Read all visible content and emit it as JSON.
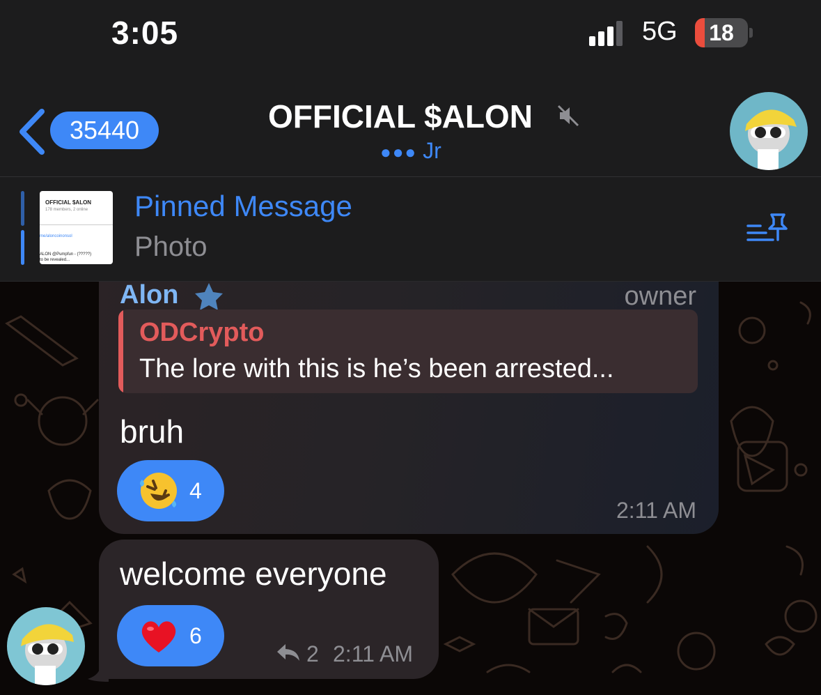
{
  "status_bar": {
    "time": "3:05",
    "network": "5G",
    "battery": "18",
    "battery_level_pct": 18,
    "signal_bars": 3
  },
  "header": {
    "unread_count": "35440",
    "title": "OFFICIAL $ALON",
    "typing_user": "Jr"
  },
  "pinned": {
    "label": "Pinned Message",
    "preview": "Photo",
    "thumb_title": "OFFICIAL $ALON",
    "thumb_sub": "178 members, 2 online",
    "thumb_link": "me/aloncoinonsol",
    "thumb_line1": "ALON @Pumpfun - (?????)",
    "thumb_line2": "to be revealed..."
  },
  "messages": [
    {
      "sender": "Alon",
      "role": "owner",
      "reply_to": {
        "name": "ODCrypto",
        "text": "The lore with this is he’s been arrested..."
      },
      "text": "bruh",
      "reaction": {
        "emoji": "rolling-on-floor-laughing",
        "count": "4"
      },
      "time": "2:11 AM"
    },
    {
      "text": "welcome everyone",
      "reaction": {
        "emoji": "red-heart",
        "count": "6"
      },
      "replies": "2",
      "time": "2:11 AM"
    }
  ],
  "colors": {
    "accent": "#3e88f7",
    "bar_bg": "#1c1c1d",
    "reply_accent": "#e25b5b",
    "sender_name": "#7fb6f4",
    "muted_text": "#8e8e93"
  }
}
